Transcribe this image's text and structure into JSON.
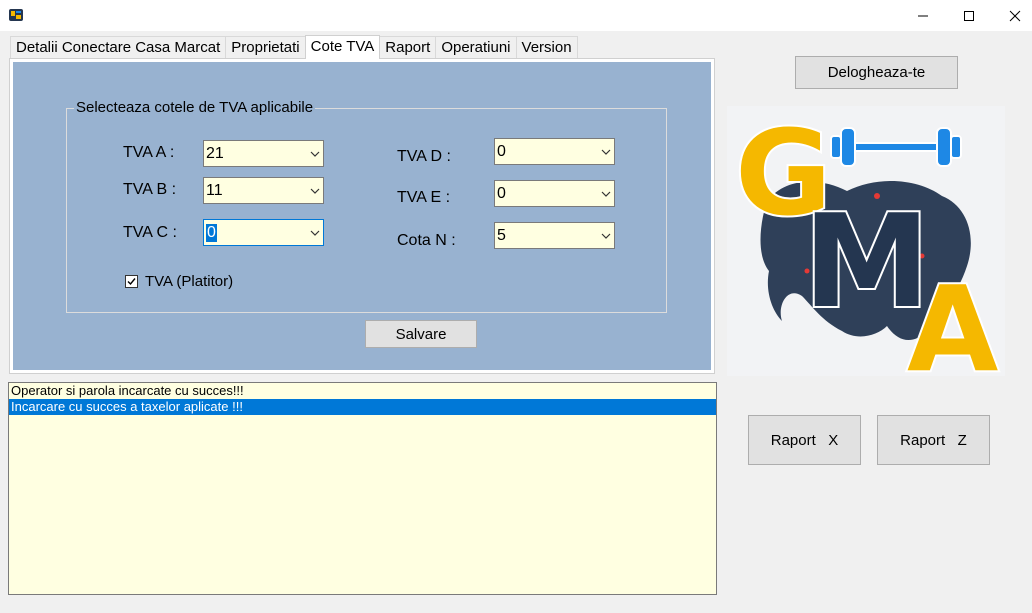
{
  "window": {
    "title": "",
    "buttons": {
      "minimize": "minimize",
      "maximize": "maximize",
      "close": "close"
    }
  },
  "tabs": [
    {
      "label": "Detalii Conectare Casa Marcat",
      "active": false
    },
    {
      "label": "Proprietati",
      "active": false
    },
    {
      "label": "Cote TVA",
      "active": true
    },
    {
      "label": "Raport",
      "active": false
    },
    {
      "label": "Operatiuni",
      "active": false
    },
    {
      "label": "Version",
      "active": false
    }
  ],
  "vat": {
    "group_title": "Selecteaza cotele de TVA aplicabile",
    "fields": {
      "a": {
        "label": "TVA A :",
        "value": "21"
      },
      "b": {
        "label": "TVA B :",
        "value": "11"
      },
      "c": {
        "label": "TVA C :",
        "value": "0"
      },
      "d": {
        "label": "TVA D :",
        "value": "0"
      },
      "e": {
        "label": "TVA E :",
        "value": "0"
      },
      "n": {
        "label": "Cota N :",
        "value": "5"
      }
    },
    "payer_checkbox": {
      "label": "TVA (Platitor)",
      "checked": true
    },
    "save_button": "Salvare"
  },
  "log": {
    "lines": [
      "Operator si parola incarcate cu succes!!!",
      "Incarcare cu succes a taxelor aplicate !!!"
    ],
    "selected_index": 1
  },
  "sidebar": {
    "logout_button": "Delogheaza-te",
    "logo_letters": {
      "g": "G",
      "m": "M",
      "a": "A"
    },
    "report_x_button": "Raport   X",
    "report_z_button": "Raport   Z"
  },
  "colors": {
    "panel_bg": "#98b2d0",
    "field_bg": "#ffffe1",
    "selection": "#0078d7",
    "logo_yellow": "#f5b800",
    "logo_navy": "#243650",
    "logo_blue": "#1e88e5"
  }
}
